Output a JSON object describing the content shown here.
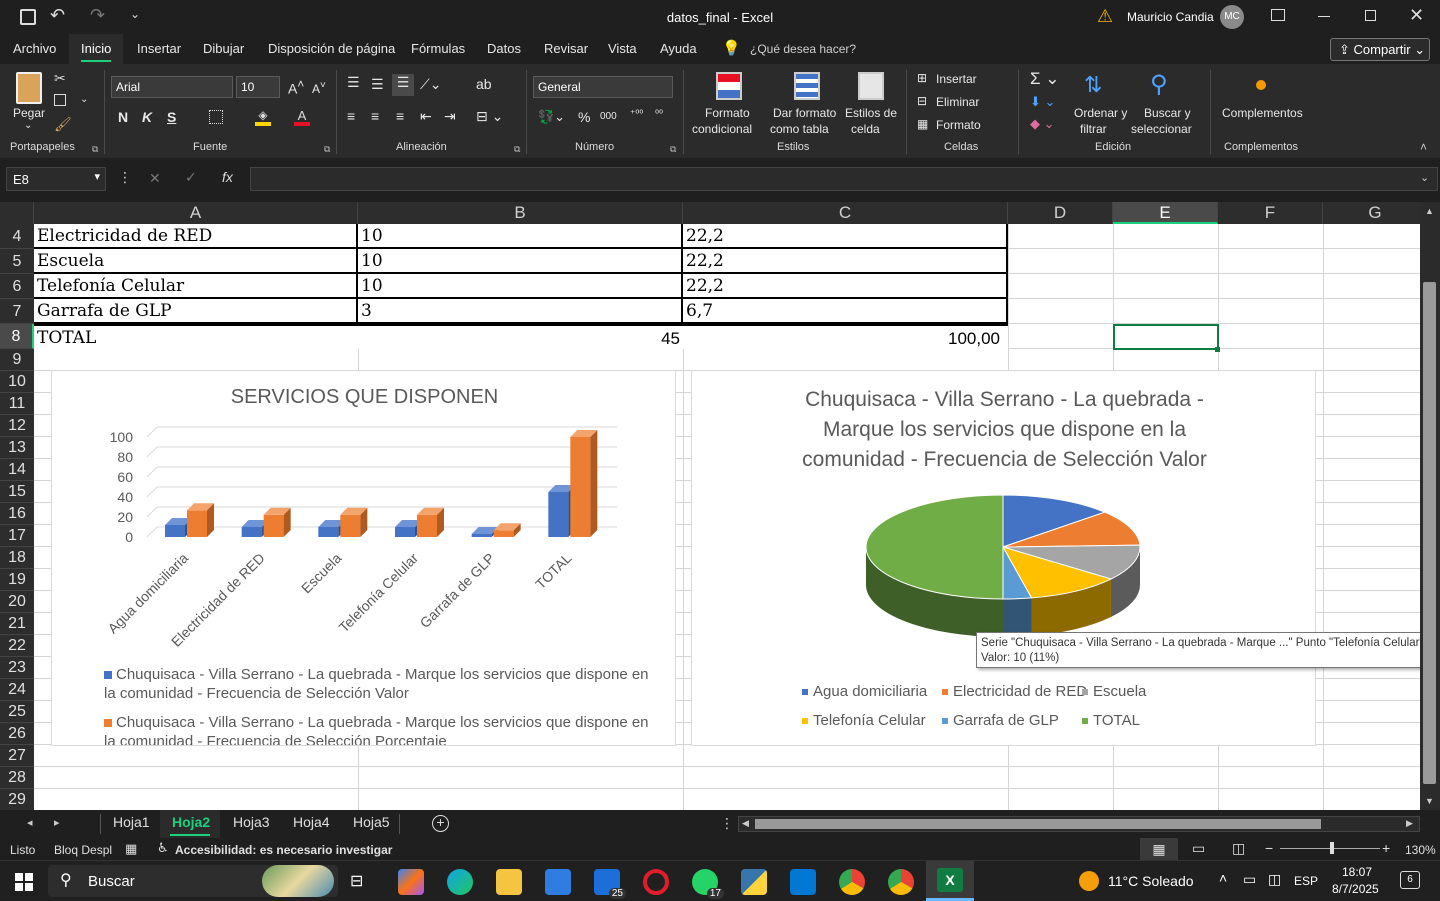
{
  "window": {
    "title": "datos_final  -  Excel",
    "user": "Mauricio Candia",
    "avatar": "MC"
  },
  "menu": [
    "Archivo",
    "Inicio",
    "Insertar",
    "Dibujar",
    "Disposición de página",
    "Fórmulas",
    "Datos",
    "Revisar",
    "Vista",
    "Ayuda"
  ],
  "tellme": "¿Qué desea hacer?",
  "share": "Compartir",
  "ribbon": {
    "paste": "Pegar",
    "font_name": "Arial",
    "font_size": "10",
    "number_format": "General",
    "bold": "N",
    "italic": "K",
    "underline": "S",
    "cond_format_1": "Formato",
    "cond_format_2": "condicional",
    "table_format_1": "Dar formato",
    "table_format_2": "como tabla",
    "cell_styles_1": "Estilos de",
    "cell_styles_2": "celda",
    "insert": "Insertar",
    "delete": "Eliminar",
    "format": "Formato",
    "sort_1": "Ordenar y",
    "sort_2": "filtrar",
    "find_1": "Buscar y",
    "find_2": "seleccionar",
    "addins": "Complementos",
    "groups": [
      "Portapapeles",
      "Fuente",
      "Alineación",
      "Número",
      "Estilos",
      "Celdas",
      "Edición",
      "Complementos"
    ]
  },
  "namebox": "E8",
  "fx": "fx",
  "columns": [
    "A",
    "B",
    "C",
    "D",
    "E",
    "F",
    "G"
  ],
  "rows": [
    "4",
    "5",
    "6",
    "7",
    "8",
    "9",
    "10",
    "11",
    "12",
    "13",
    "14",
    "15",
    "16",
    "17",
    "18",
    "19",
    "20",
    "21",
    "22",
    "23",
    "24",
    "25",
    "26",
    "27",
    "28",
    "29"
  ],
  "table": [
    {
      "a": "Electricidad de RED",
      "b": "10",
      "c": "22,2"
    },
    {
      "a": "Escuela",
      "b": "10",
      "c": "22,2"
    },
    {
      "a": "Telefonía Celular",
      "b": "10",
      "c": "22,2"
    },
    {
      "a": "Garrafa de GLP",
      "b": "3",
      "c": "6,7"
    },
    {
      "a": "TOTAL",
      "b": "45",
      "c": "100,00"
    }
  ],
  "chart_data": [
    {
      "type": "bar",
      "title": "SERVICIOS QUE DISPONEN",
      "categories": [
        "Agua domiciliaria",
        "Electricidad de RED",
        "Escuela",
        "Telefonía Celular",
        "Garrafa de GLP",
        "TOTAL"
      ],
      "series": [
        {
          "name": "Chuquisaca - Villa Serrano - La quebrada - Marque los servicios que dispone en la comunidad - Frecuencia de Selección Valor",
          "values": [
            12,
            10,
            10,
            10,
            3,
            45
          ],
          "color": "#4472c4"
        },
        {
          "name": "Chuquisaca - Villa Serrano - La quebrada - Marque los servicios que dispone en la comunidad - Frecuencia de Selección Porcentaje",
          "values": [
            26.7,
            22.2,
            22.2,
            22.2,
            6.7,
            100
          ],
          "color": "#ed7d31"
        }
      ],
      "yticks": [
        "0",
        "20",
        "40",
        "60",
        "80",
        "100"
      ],
      "ylim": [
        0,
        100
      ],
      "legend_position": "bottom"
    },
    {
      "type": "pie",
      "title": [
        "Chuquisaca - Villa Serrano - La quebrada -",
        "Marque los servicios que dispone en la",
        "comunidad - Frecuencia de Selección Valor"
      ],
      "categories": [
        "Agua domiciliaria",
        "Electricidad de RED",
        "Escuela",
        "Telefonía Celular",
        "Garrafa de GLP",
        "TOTAL"
      ],
      "values": [
        12,
        10,
        10,
        10,
        3,
        45
      ],
      "colors": [
        "#4472c4",
        "#ed7d31",
        "#a5a5a5",
        "#ffc000",
        "#5b9bd5",
        "#70ad47"
      ],
      "legend_position": "bottom"
    }
  ],
  "tooltip": {
    "line1": "Serie \"Chuquisaca - Villa Serrano - La quebrada - Marque ...\" Punto \"Telefonía Celular\"",
    "line2": "Valor: 10 (11%)"
  },
  "sheets": [
    "Hoja1",
    "Hoja2",
    "Hoja3",
    "Hoja4",
    "Hoja5"
  ],
  "active_sheet": "Hoja2",
  "status": {
    "mode": "Listo",
    "scroll": "Bloq Despl",
    "accessibility": "Accesibilidad: es necesario investigar",
    "zoom": "130%"
  },
  "taskbar": {
    "search": "Buscar",
    "weather": "11°C  Soleado",
    "lang": "ESP",
    "time": "18:07",
    "date": "8/7/2025",
    "notif": "6",
    "badge_mail": "25",
    "badge_whatsapp": "17"
  }
}
